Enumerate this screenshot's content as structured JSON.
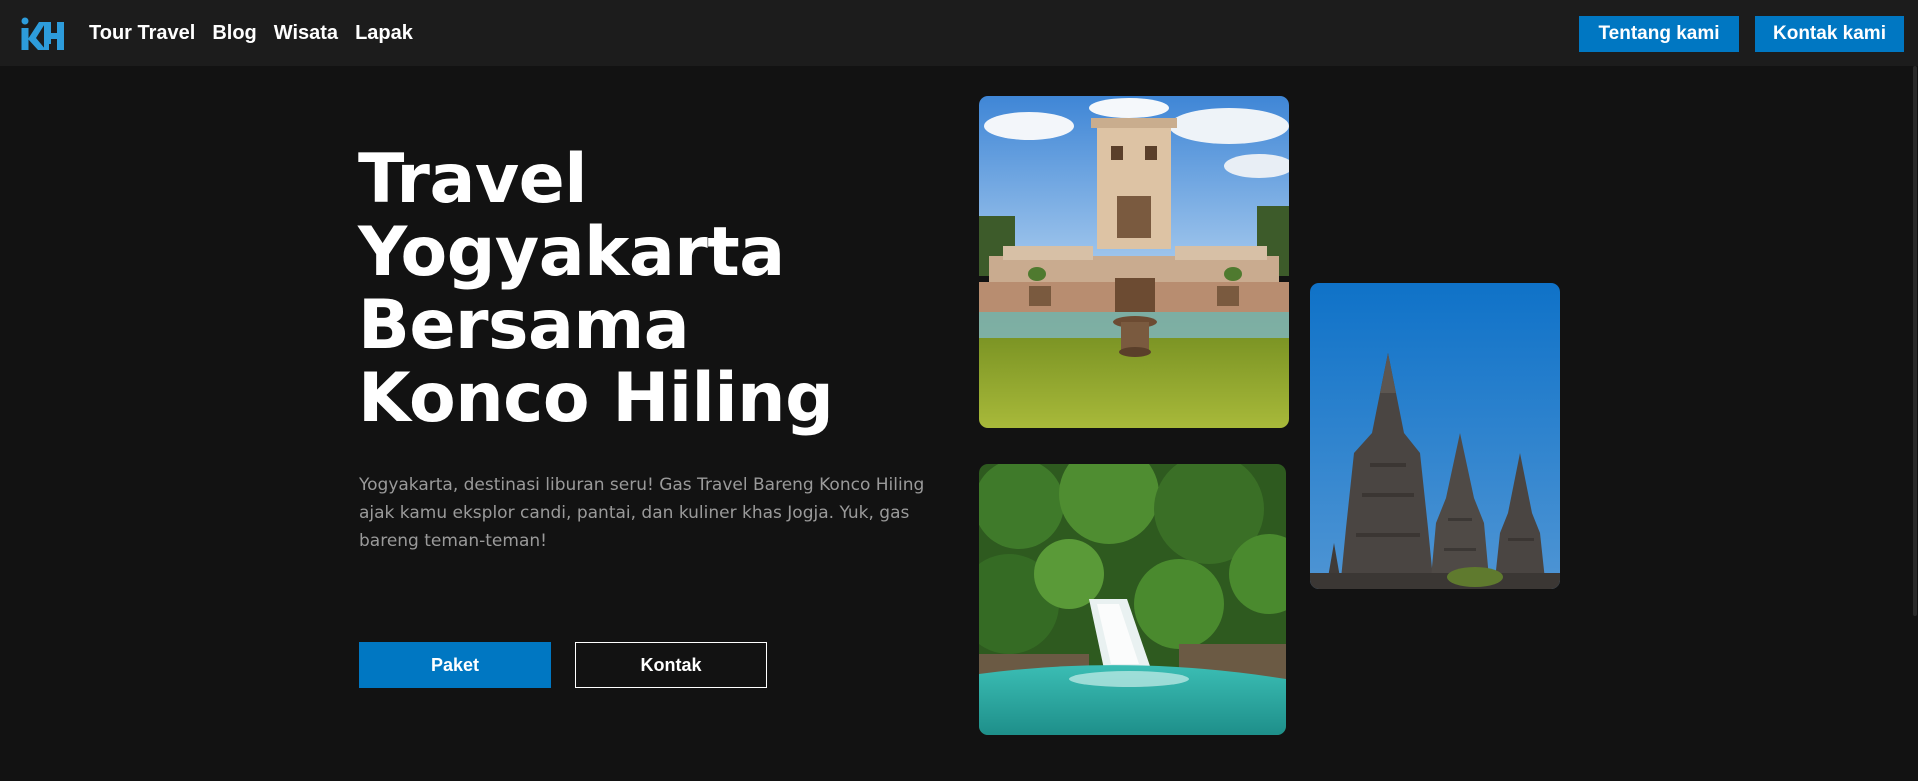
{
  "header": {
    "logo_text": "KH",
    "nav": [
      {
        "label": "Tour Travel"
      },
      {
        "label": "Blog"
      },
      {
        "label": "Wisata"
      },
      {
        "label": "Lapak"
      }
    ],
    "about_label": "Tentang kami",
    "contact_label": "Kontak kami"
  },
  "hero": {
    "title": "Travel Yogyakarta Bersama Konco Hiling",
    "description": "Yogyakarta, destinasi liburan seru! Gas Travel Bareng Konco Hiling ajak kamu eksplor candi, pantai, dan kuliner khas Jogja. Yuk, gas bareng teman-teman!",
    "primary_button": "Paket",
    "secondary_button": "Kontak"
  },
  "gallery": [
    {
      "subject": "water castle pool"
    },
    {
      "subject": "jungle waterfall"
    },
    {
      "subject": "hindu temple spires"
    }
  ],
  "colors": {
    "accent": "#0077c2",
    "background": "#121212",
    "navbar": "#1c1c1c",
    "logo": "#2d9cdb"
  }
}
